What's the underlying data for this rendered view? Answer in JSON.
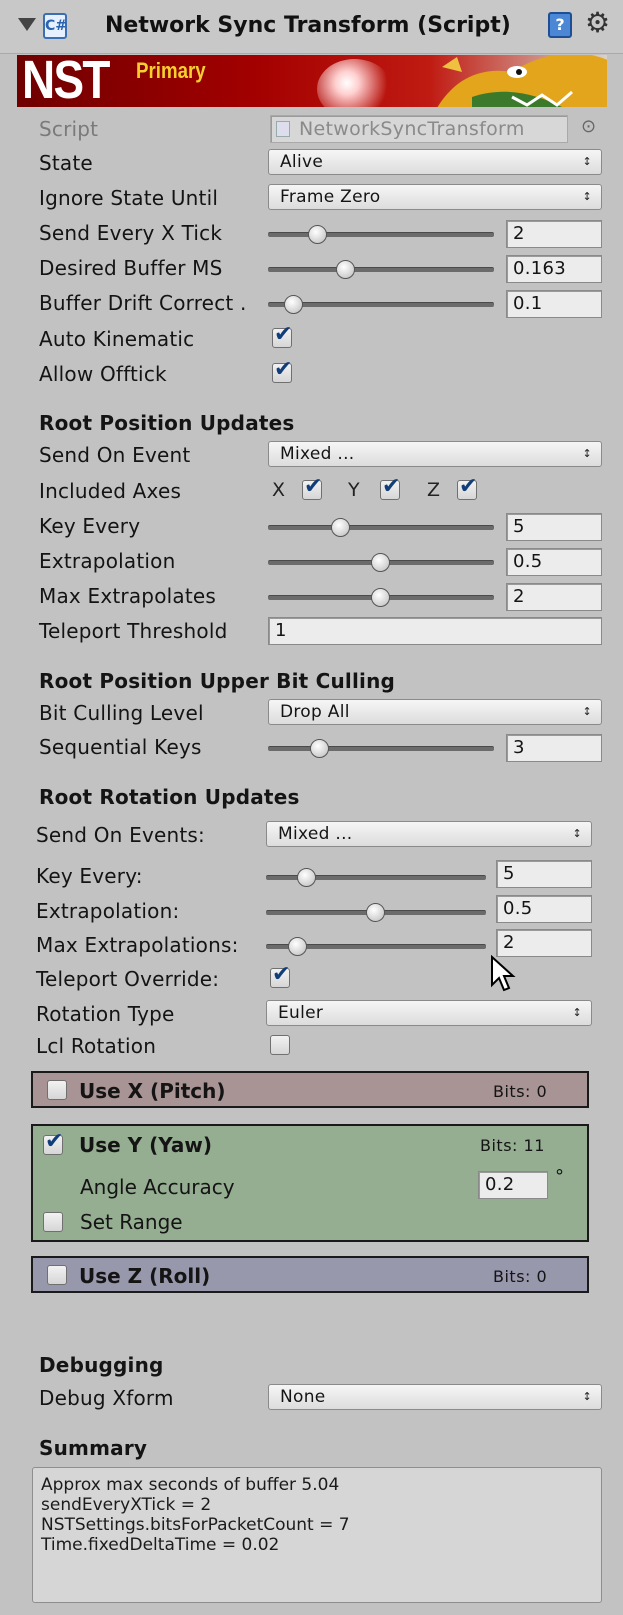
{
  "header": {
    "title": "Network Sync Transform (Script)",
    "script_icon": "C#",
    "help_icon": "?",
    "gear_icon": "⚙"
  },
  "banner": {
    "logo": "NST",
    "subtitle": "Primary"
  },
  "fields": {
    "script": {
      "label": "Script",
      "value": "NetworkSyncTransform",
      "target_icon": "⊙"
    },
    "state": {
      "label": "State",
      "value": "Alive"
    },
    "ignore_state_until": {
      "label": "Ignore State Until",
      "value": "Frame Zero"
    },
    "send_every_x_tick": {
      "label": "Send Every X Tick",
      "value": "2"
    },
    "desired_buffer_ms": {
      "label": "Desired Buffer MS",
      "value": "0.163"
    },
    "buffer_drift_correct": {
      "label": "Buffer Drift Correct .",
      "value": "0.1"
    },
    "auto_kinematic": {
      "label": "Auto Kinematic"
    },
    "allow_offtick": {
      "label": "Allow Offtick"
    }
  },
  "root_position": {
    "header": "Root Position Updates",
    "send_on_event": {
      "label": "Send On Event",
      "value": "Mixed ..."
    },
    "included_axes": {
      "label": "Included Axes",
      "x": "X",
      "y": "Y",
      "z": "Z"
    },
    "key_every": {
      "label": "Key Every",
      "value": "5"
    },
    "extrapolation": {
      "label": "Extrapolation",
      "value": "0.5"
    },
    "max_extrapolates": {
      "label": "Max Extrapolates",
      "value": "2"
    },
    "teleport_threshold": {
      "label": "Teleport Threshold",
      "value": "1"
    }
  },
  "bit_culling": {
    "header": "Root Position Upper Bit Culling",
    "level": {
      "label": "Bit Culling Level",
      "value": "Drop All"
    },
    "sequential_keys": {
      "label": "Sequential Keys",
      "value": "3"
    }
  },
  "root_rotation": {
    "header": "Root Rotation Updates",
    "send_on_events": {
      "label": "Send On Events:",
      "value": "Mixed ..."
    },
    "key_every": {
      "label": "Key Every:",
      "value": "5"
    },
    "extrapolation": {
      "label": "Extrapolation:",
      "value": "0.5"
    },
    "max_extrapolations": {
      "label": "Max Extrapolations:",
      "value": "2"
    },
    "teleport_override": {
      "label": "Teleport Override:"
    },
    "rotation_type": {
      "label": "Rotation Type",
      "value": "Euler"
    },
    "lcl_rotation": {
      "label": "Lcl Rotation"
    }
  },
  "axes": {
    "x": {
      "title": "Use X (Pitch)",
      "bits": "Bits: 0",
      "color": "#a89494"
    },
    "y": {
      "title": "Use Y (Yaw)",
      "bits": "Bits: 11",
      "color": "#95ae92",
      "angle_accuracy_label": "Angle Accuracy",
      "angle_accuracy_value": "0.2",
      "degree": "°",
      "set_range": "Set Range"
    },
    "z": {
      "title": "Use Z (Roll)",
      "bits": "Bits: 0",
      "color": "#9898ad"
    }
  },
  "debugging": {
    "header": "Debugging",
    "debug_xform": {
      "label": "Debug Xform",
      "value": "None"
    }
  },
  "summary": {
    "header": "Summary",
    "lines": [
      "Approx max seconds of buffer 5.04",
      "sendEveryXTick = 2",
      "NSTSettings.bitsForPacketCount = 7",
      "Time.fixedDeltaTime = 0.02"
    ]
  },
  "popup_arrow": "↕",
  "check_mark": "✔"
}
